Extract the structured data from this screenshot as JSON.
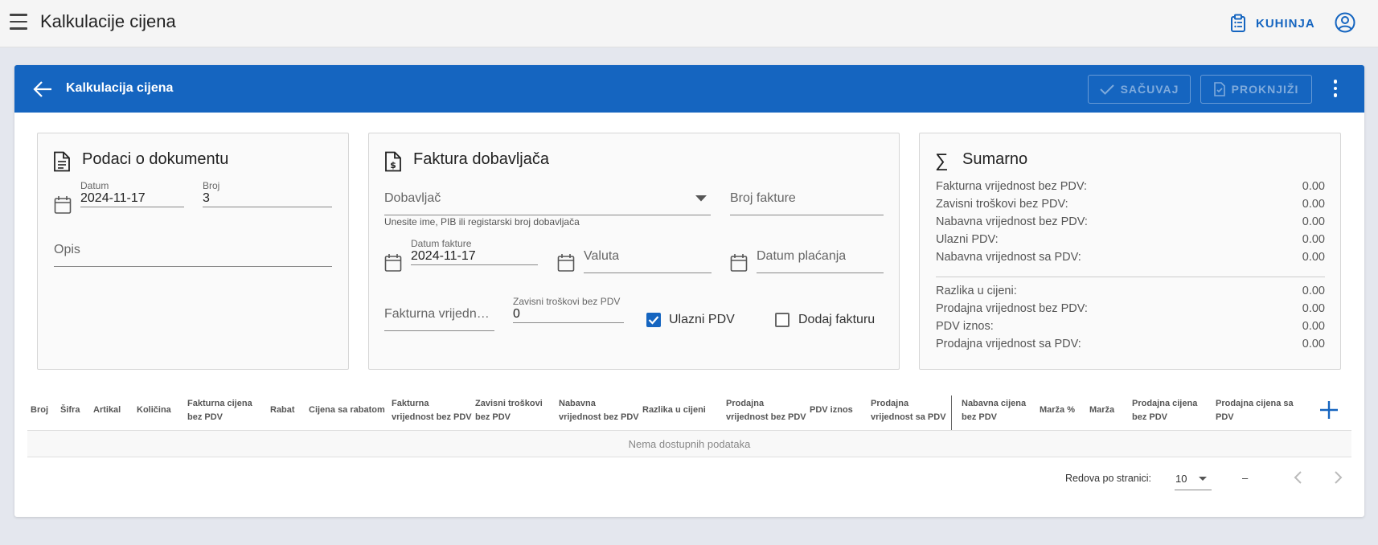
{
  "app": {
    "title": "Kalkulacije cijena"
  },
  "topbar": {
    "kitchen_label": "KUHINJA"
  },
  "card": {
    "title": "Kalkulacija cijena",
    "save_label": "SAČUVAJ",
    "post_label": "PROKNJIŽI"
  },
  "document": {
    "title": "Podaci o dokumentu",
    "date_label": "Datum",
    "date_value": "2024-11-17",
    "number_label": "Broj",
    "number_value": "3",
    "description_placeholder": "Opis"
  },
  "invoice": {
    "title": "Faktura dobavljača",
    "supplier_placeholder": "Dobavljač",
    "supplier_hint": "Unesite ime, PIB ili registarski broj dobavljača",
    "invoice_number_placeholder": "Broj fakture",
    "invoice_date_label": "Datum fakture",
    "invoice_date_value": "2024-11-17",
    "currency_placeholder": "Valuta",
    "payment_date_placeholder": "Datum plaćanja",
    "invoice_value_placeholder": "Fakturna vrijednost bez PDV",
    "dependent_costs_label": "Zavisni troškovi bez PDV",
    "dependent_costs_value": "0",
    "input_vat_label": "Ulazni PDV",
    "input_vat_checked": true,
    "add_invoice_label": "Dodaj fakturu",
    "add_invoice_checked": false
  },
  "summary": {
    "title": "Sumarno",
    "rows": [
      {
        "label": "Fakturna vrijednost bez PDV:",
        "value": "0.00"
      },
      {
        "label": "Zavisni troškovi bez PDV:",
        "value": "0.00"
      },
      {
        "label": "Nabavna vrijednost bez PDV:",
        "value": "0.00"
      },
      {
        "label": "Ulazni PDV:",
        "value": "0.00"
      },
      {
        "label": "Nabavna vrijednost sa PDV:",
        "value": "0.00"
      },
      {
        "label": "Razlika u cijeni:",
        "value": "0.00"
      },
      {
        "label": "Prodajna vrijednost bez PDV:",
        "value": "0.00"
      },
      {
        "label": "PDV iznos:",
        "value": "0.00"
      },
      {
        "label": "Prodajna vrijednost sa PDV:",
        "value": "0.00"
      }
    ]
  },
  "table": {
    "columns": [
      {
        "l1": "Broj",
        "l2": ""
      },
      {
        "l1": "Šifra",
        "l2": ""
      },
      {
        "l1": "Artikal",
        "l2": ""
      },
      {
        "l1": "Količina",
        "l2": ""
      },
      {
        "l1": "Fakturna cijena",
        "l2": "bez PDV"
      },
      {
        "l1": "Rabat",
        "l2": ""
      },
      {
        "l1": "Cijena sa rabatom",
        "l2": ""
      },
      {
        "l1": "Fakturna",
        "l2": "vrijednost bez PDV"
      },
      {
        "l1": "Zavisni troškovi",
        "l2": "bez PDV"
      },
      {
        "l1": "Nabavna",
        "l2": "vrijednost bez PDV"
      },
      {
        "l1": "Razlika u cijeni",
        "l2": ""
      },
      {
        "l1": "Prodajna",
        "l2": "vrijednost bez PDV"
      },
      {
        "l1": "PDV iznos",
        "l2": ""
      },
      {
        "l1": "Prodajna",
        "l2": "vrijednost sa PDV"
      },
      {
        "l1": "Nabavna cijena",
        "l2": "bez PDV"
      },
      {
        "l1": "Marža %",
        "l2": ""
      },
      {
        "l1": "Marža",
        "l2": ""
      },
      {
        "l1": "Prodajna cijena",
        "l2": "bez PDV"
      },
      {
        "l1": "Prodajna cijena sa",
        "l2": "PDV"
      }
    ],
    "empty_text": "Nema dostupnih podataka"
  },
  "pagination": {
    "rows_per_page_label": "Redova po stranici:",
    "rows_per_page_value": "10",
    "range_text": "–"
  },
  "colors": {
    "primary": "#1565c0",
    "page_bg": "#e4e7ee",
    "panel_bg": "#fafafa"
  }
}
